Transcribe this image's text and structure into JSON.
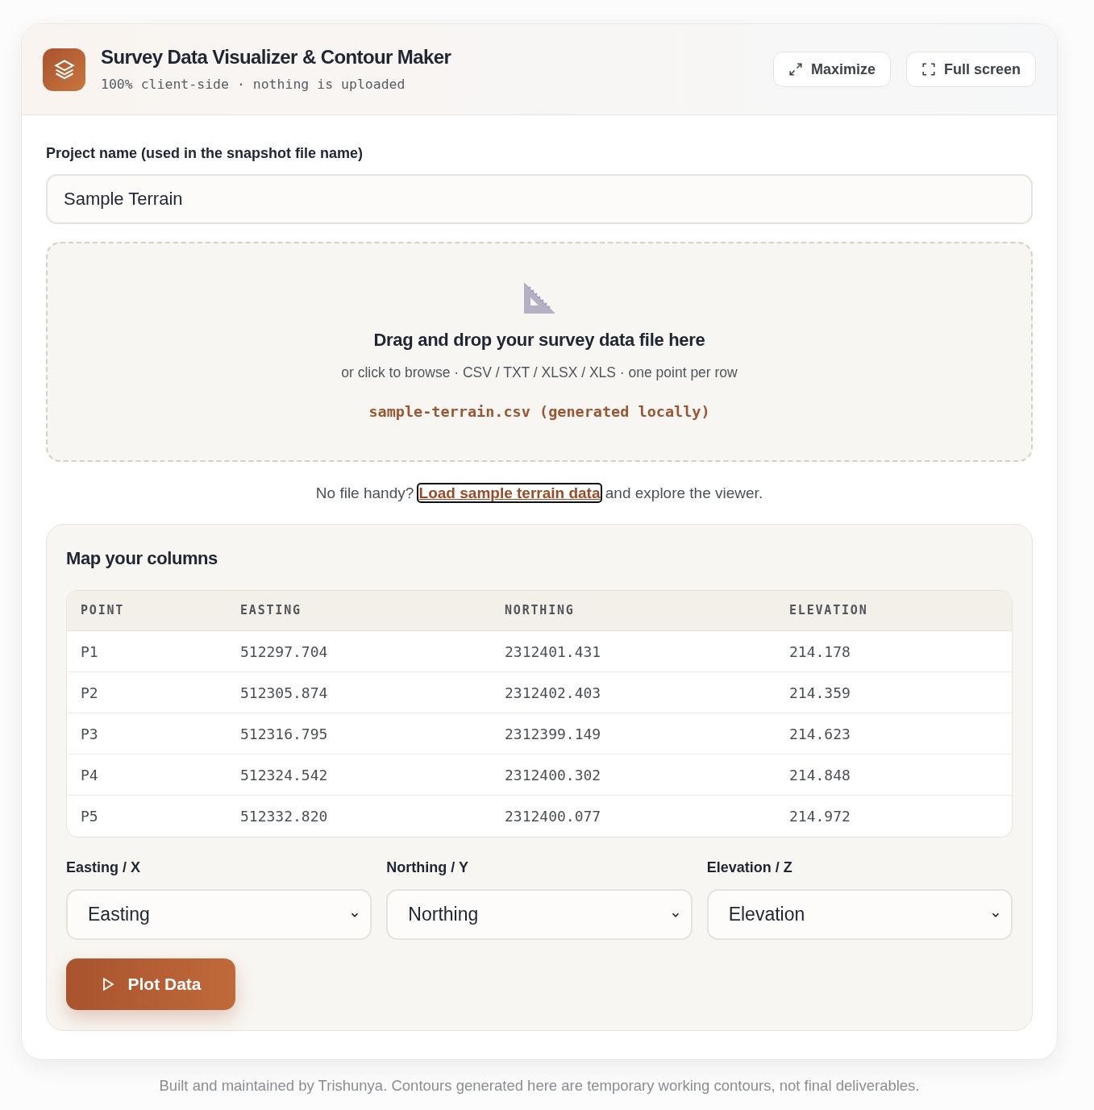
{
  "header": {
    "title": "Survey Data Visualizer & Contour Maker",
    "subtitle": "100% client-side · nothing is uploaded",
    "buttons": [
      {
        "label": "Maximize"
      },
      {
        "label": "Full screen"
      }
    ]
  },
  "project": {
    "label": "Project name (used in the snapshot file name)",
    "value": "Sample Terrain"
  },
  "dropzone": {
    "title": "Drag and drop your survey data file here",
    "hint": "or click to browse · CSV / TXT / XLSX / XLS · one point per row",
    "file": "sample-terrain.csv (generated locally)"
  },
  "sample_prompt": {
    "text_before": "No file handy?",
    "link": "Load sample terrain data",
    "text_after": "and explore the viewer.",
    "focused": true
  },
  "columns_panel": {
    "title": "Map your columns",
    "table": {
      "columns": [
        "POINT",
        "EASTING",
        "NORTHING",
        "ELEVATION"
      ],
      "rows": [
        [
          "P1",
          "512297.704",
          "2312401.431",
          "214.178"
        ],
        [
          "P2",
          "512305.874",
          "2312402.403",
          "214.359"
        ],
        [
          "P3",
          "512316.795",
          "2312399.149",
          "214.623"
        ],
        [
          "P4",
          "512324.542",
          "2312400.302",
          "214.848"
        ],
        [
          "P5",
          "512332.820",
          "2312400.077",
          "214.972"
        ]
      ]
    },
    "mappings": [
      {
        "label": "Easting / X",
        "value": "Easting"
      },
      {
        "label": "Northing / Y",
        "value": "Northing"
      },
      {
        "label": "Elevation / Z",
        "value": "Elevation"
      }
    ],
    "plot_button": "Plot Data"
  },
  "footer": "Built and maintained by Trishunya. Contours generated here are temporary working contours, not final deliverables."
}
